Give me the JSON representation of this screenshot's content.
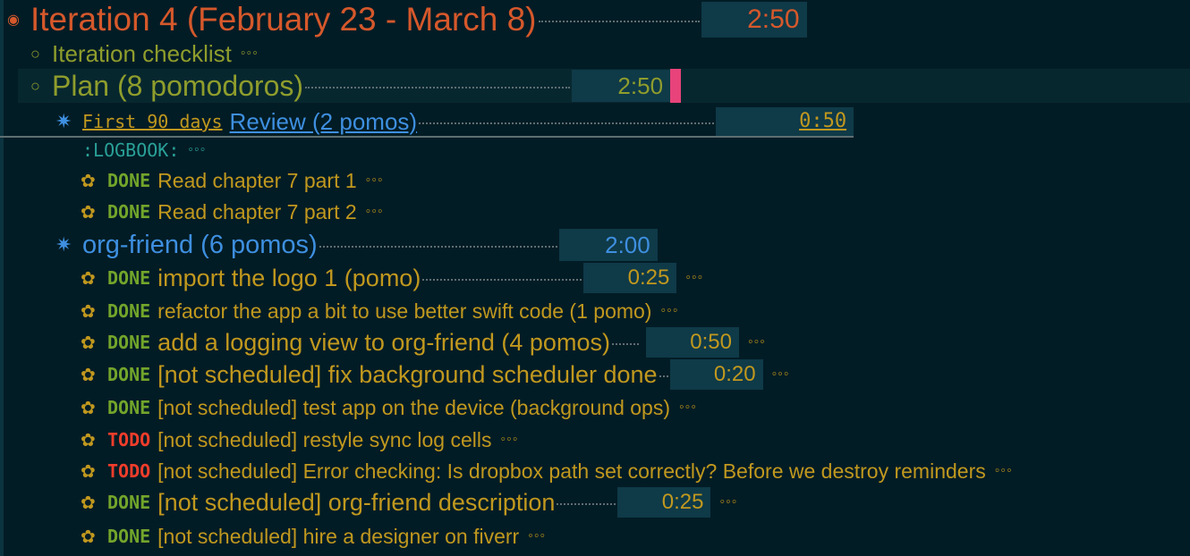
{
  "iteration": {
    "bullet": "◉",
    "title": "Iteration 4 (February 23 - March 8)",
    "time": "2:50"
  },
  "checklist": {
    "bullet": "○",
    "title": "Iteration checklist",
    "ellipsis": "◦◦◦"
  },
  "plan": {
    "bullet": "○",
    "title": "Plan (8 pomodoros)",
    "time": "2:50"
  },
  "review": {
    "bullet": "✷",
    "prefix": "First 90 days",
    "title": "Review (2 pomos)",
    "time": "0:50"
  },
  "logbook": {
    "label": ":LOGBOOK:",
    "ellipsis": "◦◦◦"
  },
  "review_tasks": [
    {
      "bullet": "✿",
      "kw": "DONE",
      "text": "Read chapter 7 part 1",
      "ellipsis": "◦◦◦"
    },
    {
      "bullet": "✿",
      "kw": "DONE",
      "text": "Read chapter 7 part 2",
      "ellipsis": "◦◦◦"
    }
  ],
  "orgfriend": {
    "bullet": "✷",
    "title": "org-friend (6 pomos)",
    "time": "2:00"
  },
  "tasks": [
    {
      "bullet": "✿",
      "kw": "DONE",
      "text": "import the logo 1 (pomo)",
      "time": "0:25",
      "ellipsis": "◦◦◦"
    },
    {
      "bullet": "✿",
      "kw": "DONE",
      "text": "refactor the app a bit to use better swift code (1 pomo)",
      "ellipsis": "◦◦◦"
    },
    {
      "bullet": "✿",
      "kw": "DONE",
      "text": "add a logging view to org-friend (4 pomos)",
      "time": "0:50",
      "ellipsis": "◦◦◦"
    },
    {
      "bullet": "✿",
      "kw": "DONE",
      "text": "[not scheduled] fix background scheduler done",
      "time": "0:20",
      "ellipsis": "◦◦◦"
    },
    {
      "bullet": "✿",
      "kw": "DONE",
      "text": "[not scheduled] test app on the device (background ops)",
      "ellipsis": "◦◦◦"
    },
    {
      "bullet": "✿",
      "kw": "TODO",
      "text": "[not scheduled] restyle sync log cells",
      "ellipsis": "◦◦◦"
    },
    {
      "bullet": "✿",
      "kw": "TODO",
      "text": "[not scheduled] Error checking: Is dropbox path set correctly? Before we destroy reminders",
      "ellipsis": "◦◦◦"
    },
    {
      "bullet": "✿",
      "kw": "DONE",
      "text": "[not scheduled] org-friend description",
      "time": "0:25",
      "ellipsis": "◦◦◦"
    },
    {
      "bullet": "✿",
      "kw": "DONE",
      "text": "[not scheduled] hire a designer on fiverr",
      "ellipsis": "◦◦◦"
    }
  ],
  "colors": {
    "background": "#021c25",
    "level1": "#d6582b",
    "level2": "#8f9d2c",
    "level3": "#3e8fe0",
    "task": "#c1981e",
    "done": "#72a52b",
    "todo": "#f03d2b",
    "timebox": "#0f3a48",
    "cursor": "#e8437a",
    "logbook": "#2aa198"
  }
}
